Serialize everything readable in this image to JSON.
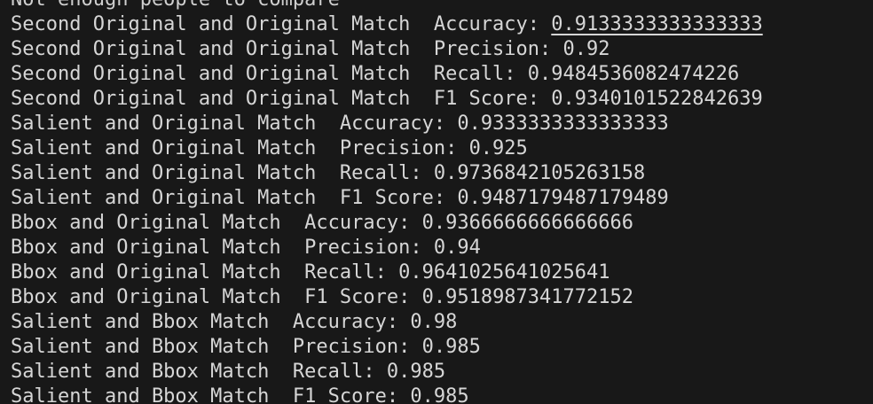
{
  "terminal": {
    "first_line": "Not enough people to compare",
    "lines": [
      {
        "prefix": "Second Original and Original Match  Accuracy: ",
        "value": "0.9133333333333333",
        "underline": true
      },
      {
        "prefix": "Second Original and Original Match  Precision: ",
        "value": "0.92"
      },
      {
        "prefix": "Second Original and Original Match  Recall: ",
        "value": "0.9484536082474226"
      },
      {
        "prefix": "Second Original and Original Match  F1 Score: ",
        "value": "0.9340101522842639"
      },
      {
        "prefix": "Salient and Original Match  Accuracy: ",
        "value": "0.9333333333333333"
      },
      {
        "prefix": "Salient and Original Match  Precision: ",
        "value": "0.925"
      },
      {
        "prefix": "Salient and Original Match  Recall: ",
        "value": "0.9736842105263158"
      },
      {
        "prefix": "Salient and Original Match  F1 Score: ",
        "value": "0.9487179487179489"
      },
      {
        "prefix": "Bbox and Original Match  Accuracy: ",
        "value": "0.9366666666666666"
      },
      {
        "prefix": "Bbox and Original Match  Precision: ",
        "value": "0.94"
      },
      {
        "prefix": "Bbox and Original Match  Recall: ",
        "value": "0.9641025641025641"
      },
      {
        "prefix": "Bbox and Original Match  F1 Score: ",
        "value": "0.9518987341772152"
      },
      {
        "prefix": "Salient and Bbox Match  Accuracy: ",
        "value": "0.98"
      },
      {
        "prefix": "Salient and Bbox Match  Precision: ",
        "value": "0.985"
      },
      {
        "prefix": "Salient and Bbox Match  Recall: ",
        "value": "0.985"
      },
      {
        "prefix": "Salient and Bbox Match  F1 Score: ",
        "value": "0.985"
      }
    ]
  },
  "colors": {
    "background": "#181818",
    "text": "#d6d6d6"
  }
}
